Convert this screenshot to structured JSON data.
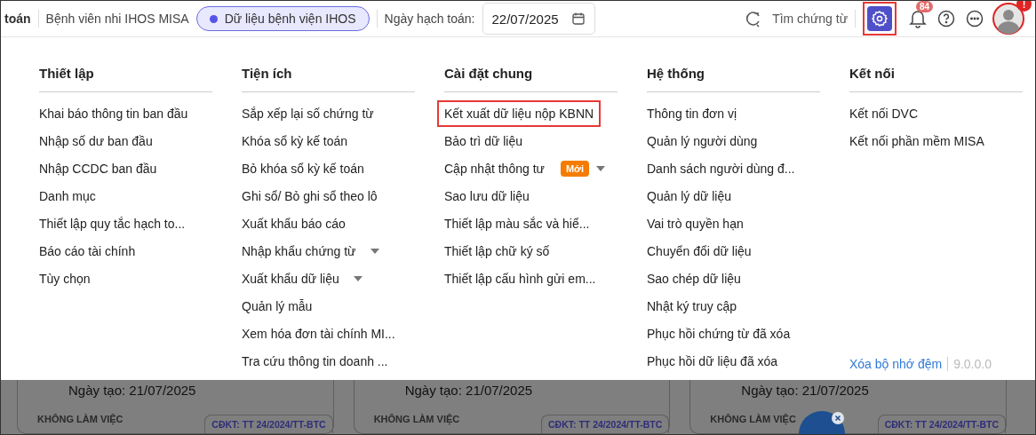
{
  "header": {
    "module": "toán",
    "unit": "Bệnh viên nhi IHOS MISA",
    "database": "Dữ liệu bệnh viện IHOS",
    "date_label": "Ngày hạch toán:",
    "date_value": "22/07/2025",
    "search_label": "Tìm chứng từ",
    "settings": {
      "selected": true,
      "highlighted": true
    },
    "notification_count": "84",
    "avatar_alert": "!"
  },
  "menu_columns": [
    {
      "title": "Thiết lập",
      "items": [
        {
          "label": "Khai báo thông tin ban đầu"
        },
        {
          "label": "Nhập số dư ban đầu"
        },
        {
          "label": "Nhập CCDC ban đầu"
        },
        {
          "label": "Danh mục"
        },
        {
          "label": "Thiết lập quy tắc hạch to..."
        },
        {
          "label": "Báo cáo tài chính"
        },
        {
          "label": "Tùy chọn"
        }
      ]
    },
    {
      "title": "Tiện ích",
      "items": [
        {
          "label": "Sắp xếp lại số chứng từ"
        },
        {
          "label": "Khóa sổ kỳ kế toán"
        },
        {
          "label": "Bỏ khóa sổ kỳ kế toán"
        },
        {
          "label": "Ghi sổ/ Bỏ ghi sổ theo lô"
        },
        {
          "label": "Xuất khẩu báo cáo"
        },
        {
          "label": "Nhập khẩu chứng từ",
          "kind": "dropdown"
        },
        {
          "label": "Xuất khẩu dữ liệu",
          "kind": "dropdown"
        },
        {
          "label": "Quản lý mẫu"
        },
        {
          "label": "Xem hóa đơn tài chính MI..."
        },
        {
          "label": "Tra cứu thông tin doanh ..."
        }
      ]
    },
    {
      "title": "Cài đặt chung",
      "items": [
        {
          "label": "Kết xuất dữ liệu nộp KBNN",
          "highlighted": true
        },
        {
          "label": "Bảo trì dữ liệu"
        },
        {
          "label": "Cập nhật thông tư",
          "kind": "dropdown",
          "badge": "Mới"
        },
        {
          "label": "Sao lưu dữ liệu"
        },
        {
          "label": "Thiết lập màu sắc và hiể..."
        },
        {
          "label": "Thiết lập chữ ký số"
        },
        {
          "label": "Thiết lập cấu hình gửi em..."
        }
      ]
    },
    {
      "title": "Hệ thống",
      "items": [
        {
          "label": "Thông tin đơn vị"
        },
        {
          "label": "Quản lý người dùng"
        },
        {
          "label": "Danh sách người dùng đ..."
        },
        {
          "label": "Quản lý dữ liệu"
        },
        {
          "label": "Vai trò quyền hạn"
        },
        {
          "label": "Chuyển đổi dữ liệu"
        },
        {
          "label": "Sao chép dữ liệu"
        },
        {
          "label": "Nhật ký truy cập"
        },
        {
          "label": "Phục hồi chứng từ đã xóa"
        },
        {
          "label": "Phục hồi dữ liệu đã xóa"
        }
      ]
    },
    {
      "title": "Kết nối",
      "items": [
        {
          "label": "Kết nối DVC"
        },
        {
          "label": "Kết nối phần mềm MISA"
        }
      ]
    }
  ],
  "menu_footer": {
    "clear_cache": "Xóa bộ nhớ đệm",
    "version": "9.0.0.0"
  },
  "cards": [
    {
      "created": "Ngày tạo: 21/07/2025",
      "status": "KHÔNG LÀM VIỆC",
      "standard": "CĐKT: TT 24/2024/TT-BTC"
    },
    {
      "created": "Ngày tạo: 21/07/2025",
      "status": "KHÔNG LÀM VIỆC",
      "standard": "CĐKT: TT 24/2024/TT-BTC"
    },
    {
      "created": "Ngày tạo: 21/07/2025",
      "status": "KHÔNG LÀM VIỆC",
      "standard": "CĐKT: TT 24/2024/TT-BTC"
    }
  ]
}
